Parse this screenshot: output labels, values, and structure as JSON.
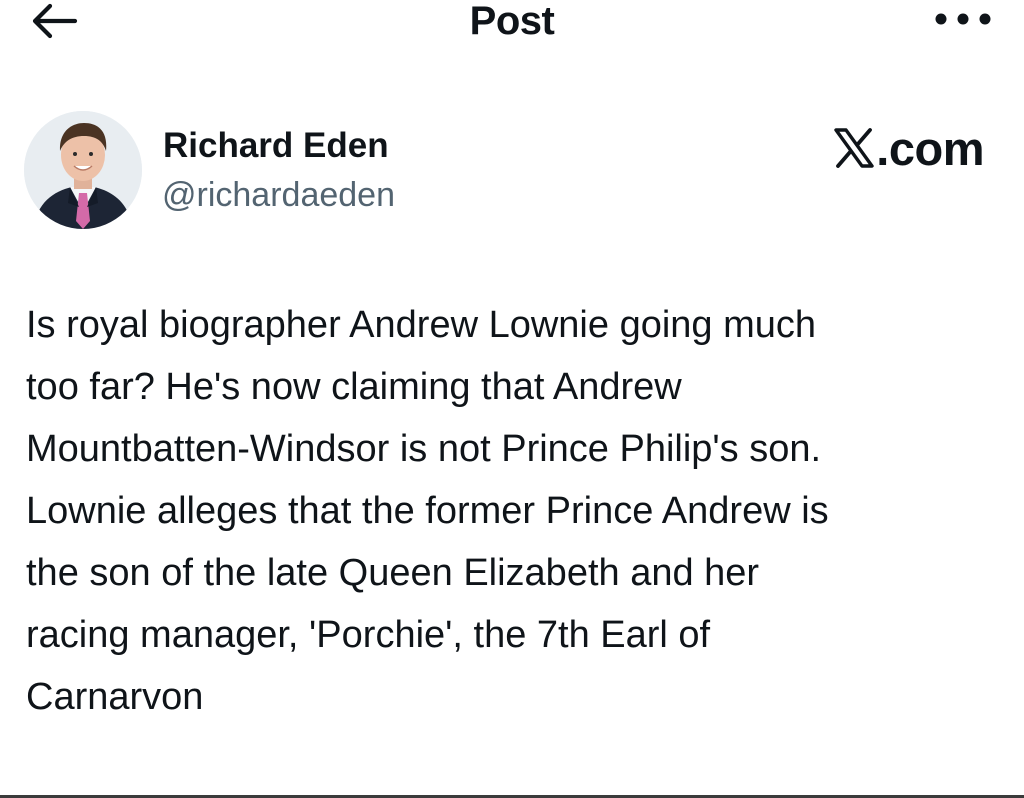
{
  "header": {
    "back_icon": "arrow-left-icon",
    "title": "Post",
    "more_icon": "more-horizontal-icon"
  },
  "author": {
    "avatar": "avatar",
    "name": "Richard Eden",
    "handle": "@richardaeden"
  },
  "watermark": {
    "logo_icon": "x-logo-icon",
    "text": ".com"
  },
  "post": {
    "lines": [
      "Is royal biographer Andrew Lownie going much",
      "too far? He's now claiming that Andrew",
      "Mountbatten-Windsor is not Prince Philip's son.",
      "Lownie alleges that the former Prince Andrew is",
      "the son of the late Queen Elizabeth and her",
      "racing manager, 'Porchie', the 7th Earl of",
      "Carnarvon"
    ]
  },
  "colors": {
    "text_primary": "#0f1419",
    "text_secondary": "#536471",
    "background": "#ffffff"
  }
}
